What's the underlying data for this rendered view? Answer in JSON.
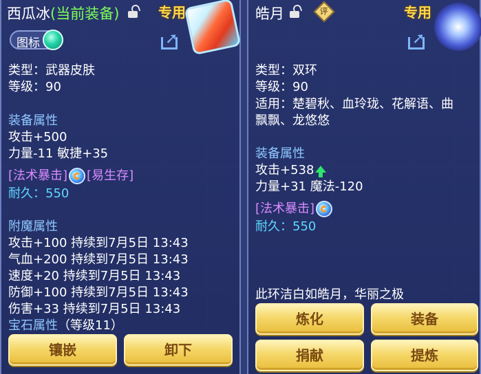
{
  "left": {
    "name": "西瓜冰",
    "name_suffix": "(当前装备)",
    "exclusive": "专用",
    "icon_toggle_label": "图标",
    "type": "类型：武器皮肤",
    "level": "等级：90",
    "equip_attr_header": "装备属性",
    "attr1": "攻击+500",
    "attr2": "力量-11 敏捷+35",
    "skill1": "[法术暴击]",
    "skill2": "[易生存]",
    "durability_label": "耐久：",
    "durability_value": "550",
    "enchant_header": "附魔属性",
    "enchant": [
      "攻击+100 持续到7月5日 13:43",
      "气血+200 持续到7月5日 13:43",
      "速度+20 持续到7月5日 13:43",
      "防御+100 持续到7月5日 13:43",
      "伤害+33 持续到7月5日 13:43"
    ],
    "gem_header": "宝石属性",
    "gem_level": "（等级11）",
    "buttons": {
      "inlay": "镶嵌",
      "unequip": "卸下"
    }
  },
  "right": {
    "name": "皓月",
    "evaluate": "评",
    "exclusive": "专用",
    "type": "类型：双环",
    "level": "等级：90",
    "applicable_line1": "适用：楚碧秋、血玲珑、花解语、曲",
    "applicable_line2": "飘飘、龙悠悠",
    "equip_attr_header": "装备属性",
    "attr1": "攻击+538",
    "attr2": "力量+31 魔法-120",
    "skill1": "[法术暴击]",
    "durability_label": "耐久：",
    "durability_value": "550",
    "description": "此环洁白如皓月，华丽之极",
    "buttons": {
      "refine": "炼化",
      "equip": "装备",
      "donate": "捐献",
      "extract": "提炼"
    }
  },
  "colors": {
    "panel": "#283470",
    "header_blue": "#8fc8ff",
    "value_cyan": "#5fd8ff",
    "skill_purple": "#d98bff",
    "current_equip_green": "#7dff5a",
    "exclusive_gold": "#ffd84a",
    "button_gold": "#f5d86a"
  },
  "icons": [
    "lock-icon",
    "share-icon",
    "evaluate-icon",
    "skill-icon",
    "up-arrow-icon",
    "toggle-knob-icon"
  ]
}
